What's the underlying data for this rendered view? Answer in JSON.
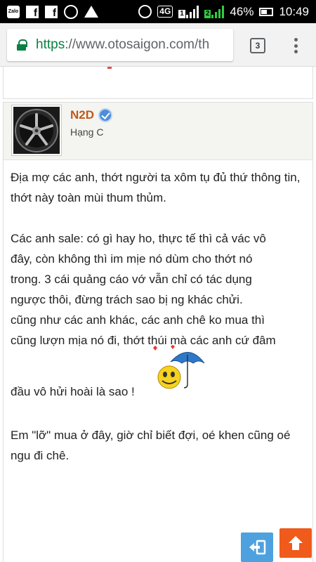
{
  "status_bar": {
    "left_icons": [
      "zalo-icon",
      "facebook-icon",
      "facebook-icon",
      "viber-icon",
      "delta-icon"
    ],
    "zalo_label": "Zalo",
    "network": "4G",
    "sim1": "1",
    "sim2": "2",
    "battery": "46%",
    "time": "10:49"
  },
  "browser": {
    "url_scheme": "https",
    "url_rest": "://www.otosaigon.com/th",
    "tab_count": "3"
  },
  "post": {
    "author": "N2D",
    "rank": "Hạng C",
    "paragraph1": "Địa mợ các anh, thớt người ta xôm tụ đủ thứ thông tin, thớt này toàn mùi thum thủm.",
    "paragraph2_lines": [
      "Các anh sale: có gì hay ho, thực tế thì cả vác vô",
      "đây, còn không thì im mịe nó dùm cho thớt nó",
      "trong. 3 cái quảng cáo vớ vẫn chỉ có tác dụng",
      "ngược thôi, đừng trách sao bị ng khác chửi.",
      "cũng như các anh khác, các anh chê ko mua thì",
      "cũng lượn mịa nó đi, thớt thúi mà các anh cứ đâm"
    ],
    "paragraph2_last": "đầu vô hửi hoài là sao !",
    "paragraph3": "Em \"lỡ\" mua ở đây, giờ chỉ biết đợi, oé khen cũng oé ngu đi chê."
  },
  "colors": {
    "author": "#c0591d",
    "scroll_top_button": "#f05a1a",
    "exit_button": "#4ea1df",
    "secure_scheme": "#0b8043"
  }
}
